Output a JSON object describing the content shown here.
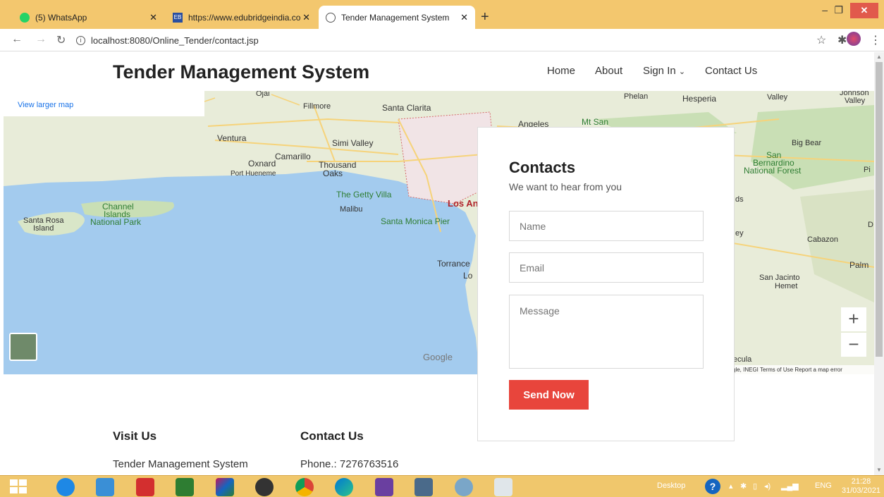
{
  "browser": {
    "tabs": [
      {
        "title": "(5) WhatsApp",
        "active": false
      },
      {
        "title": "https://www.edubridgeindia.com",
        "active": false
      },
      {
        "title": "Tender Management System",
        "active": true
      }
    ],
    "url": "localhost:8080/Online_Tender/contact.jsp"
  },
  "site": {
    "title": "Tender Management System",
    "nav": [
      "Home",
      "About",
      "Sign In",
      "Contact Us"
    ]
  },
  "map": {
    "view_larger": "View larger map",
    "attribution": "gle, INEGI   Terms of Use   Report a map error",
    "google": "Google",
    "labels": [
      "Ojai",
      "Fillmore",
      "Santa Clarita",
      "Ventura",
      "Simi Valley",
      "Camarillo",
      "Oxnard",
      "Thousand",
      "Oaks",
      "Port Hueneme",
      "The Getty Villa",
      "Malibu",
      "Santa Monica Pier",
      "Los An",
      "Torrance",
      "Lo",
      "Channel",
      "Islands",
      "National Park",
      "Santa Rosa",
      "Island",
      "Phelan",
      "Hesperia",
      "Valley",
      "Johnson",
      "Valley",
      "Angeles",
      "Mt San",
      "Big Bear",
      "San",
      "Bernardino",
      "National Forest",
      "Pi",
      "ds",
      "ey",
      "Cabazon",
      "D",
      "Palm",
      "San Jacinto",
      "Hemet",
      "ecula"
    ],
    "zoom_in": "+",
    "zoom_out": "−",
    "colors": {
      "land": "#e8ecd9",
      "water": "#a3cbee",
      "park": "#c9dfb5",
      "road": "#f6d37a"
    }
  },
  "contact_form": {
    "title": "Contacts",
    "subtitle": "We want to hear from you",
    "name_placeholder": "Name",
    "email_placeholder": "Email",
    "message_placeholder": "Message",
    "send_label": "Send Now",
    "accent": "#e8453c"
  },
  "footer": {
    "visit_title": "Visit Us",
    "visit_text": "Tender Management System",
    "contact_title": "Contact Us",
    "contact_text": "Phone.: 7276763516"
  },
  "taskbar": {
    "desktop_label": "Desktop",
    "lang": "ENG",
    "time": "21:28",
    "date": "31/03/2021"
  }
}
